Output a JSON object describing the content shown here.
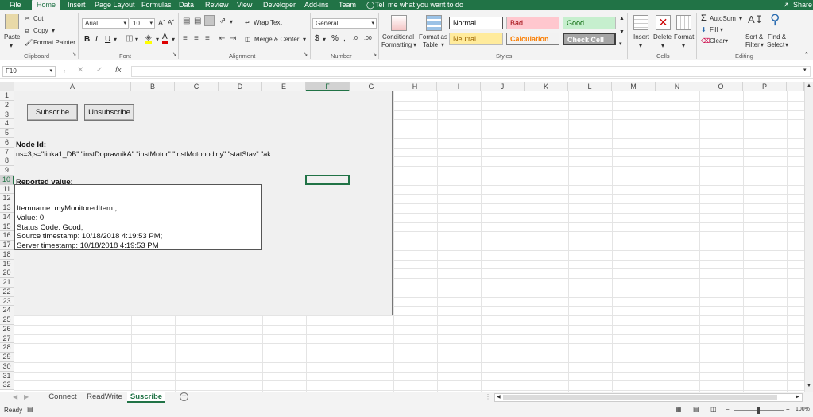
{
  "ribbon_tabs": [
    "File",
    "Home",
    "Insert",
    "Page Layout",
    "Formulas",
    "Data",
    "Review",
    "View",
    "Developer",
    "Add-ins",
    "Team"
  ],
  "active_tab": "Home",
  "tell_me": "Tell me what you want to do",
  "share": "Share",
  "clipboard": {
    "paste": "Paste",
    "cut": "Cut",
    "copy": "Copy",
    "format_painter": "Format Painter",
    "label": "Clipboard"
  },
  "font": {
    "name": "Arial",
    "size": "10",
    "label": "Font"
  },
  "alignment": {
    "wrap": "Wrap Text",
    "merge": "Merge & Center",
    "label": "Alignment"
  },
  "number": {
    "format": "General",
    "label": "Number"
  },
  "styles": {
    "conditional": "Conditional",
    "formatting": "Formatting",
    "format_as": "Format as",
    "table": "Table",
    "normal": "Normal",
    "bad": "Bad",
    "good": "Good",
    "neutral": "Neutral",
    "calculation": "Calculation",
    "check_cell": "Check Cell",
    "label": "Styles"
  },
  "cells": {
    "insert": "Insert",
    "delete": "Delete",
    "format": "Format",
    "label": "Cells"
  },
  "editing": {
    "autosum": "AutoSum",
    "fill": "Fill",
    "clear": "Clear",
    "sort": "Sort &",
    "filter": "Filter",
    "find": "Find &",
    "select": "Select",
    "label": "Editing"
  },
  "name_box": "F10",
  "columns": [
    "A",
    "B",
    "C",
    "D",
    "E",
    "F",
    "G",
    "H",
    "I",
    "J",
    "K",
    "L",
    "M",
    "N",
    "O",
    "P"
  ],
  "selected_column": "F",
  "selected_row": "10",
  "panel": {
    "subscribe": "Subscribe",
    "unsubscribe": "Unsubscribe",
    "node_id_label": "Node Id:",
    "node_id_value": "ns=3;s=\"linka1_DB\".\"instDopravnikA\".\"instMotor\".\"instMotohodiny\".\"statStav\".\"ak",
    "reported_label": "Reported value:",
    "lines": [
      "Itemname: myMonitoredItem ;",
      "Value: 0;",
      "Status Code: Good;",
      "Source timestamp: 10/18/2018 4:19:53 PM;",
      "Server timestamp: 10/18/2018 4:19:53 PM"
    ]
  },
  "sheets": [
    "Connect",
    "ReadWrite",
    "Suscribe"
  ],
  "active_sheet": "Suscribe",
  "status": {
    "ready": "Ready",
    "zoom": "100%"
  },
  "colors": {
    "accent": "#217346",
    "bad_bg": "#ffc7ce",
    "good_bg": "#c6efce",
    "neutral_bg": "#ffeb9c"
  }
}
